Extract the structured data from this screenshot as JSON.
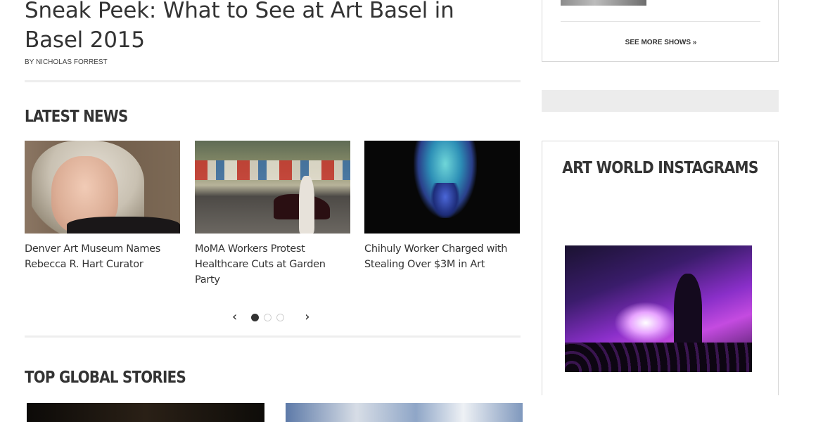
{
  "article": {
    "title": "Sneak Peek: What to See at Art Basel in Basel 2015",
    "byline": "BY NICHOLAS FORREST"
  },
  "latest_news": {
    "heading": "LATEST NEWS",
    "items": [
      {
        "caption": "Denver Art Museum Names Rebecca R. Hart Curator"
      },
      {
        "caption": "MoMA Workers Protest Healthcare Cuts at Garden Party"
      },
      {
        "caption": "Chihuly Worker Charged with Stealing Over $3M in Art"
      }
    ],
    "pager": {
      "prev": "‹",
      "next": "›",
      "pages": 3,
      "current": 1
    }
  },
  "top_global": {
    "heading": "TOP GLOBAL STORIES"
  },
  "sidebar": {
    "shows": {
      "see_more_label": "SEE MORE SHOWS »"
    },
    "instagrams": {
      "title": "ART WORLD INSTAGRAMS"
    }
  }
}
